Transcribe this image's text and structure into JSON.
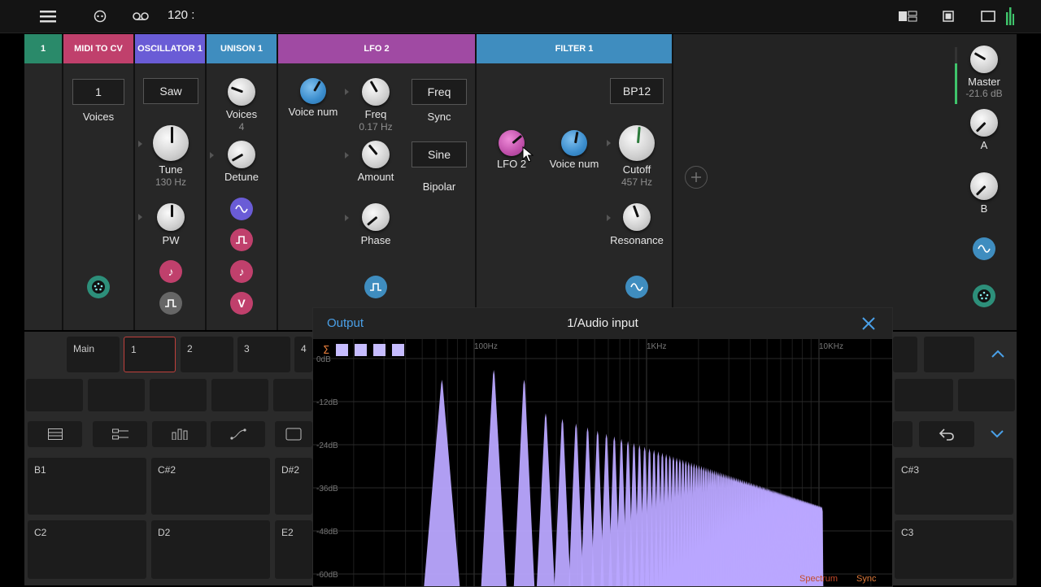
{
  "topbar": {
    "tempo": "120 :",
    "icons": [
      "menu-icon",
      "link-icon",
      "cassette-icon",
      "layout-icon",
      "single-view-icon",
      "window-icon",
      "level-meter-icon"
    ]
  },
  "tracks": {
    "selected": "1"
  },
  "modules": {
    "midi_to_cv": {
      "title": "MIDI TO CV",
      "voices_value": "1",
      "voices_label": "Voices",
      "color": "#c0406c"
    },
    "oscillator": {
      "title": "OSCILLATOR 1",
      "wave_value": "Saw",
      "tune_label": "Tune",
      "tune_value": "130 Hz",
      "pw_label": "PW",
      "color": "#6a5cd6"
    },
    "unison": {
      "title": "UNISON 1",
      "voices_label": "Voices",
      "voices_value": "4",
      "detune_label": "Detune",
      "color": "#3f8dbf",
      "v_label": "V"
    },
    "lfo": {
      "title": "LFO 2",
      "voice_num_label": "Voice num",
      "freq_label": "Freq",
      "freq_value": "0.17 Hz",
      "freq_mode": "Freq",
      "sync_label": "Sync",
      "amount_label": "Amount",
      "shape_value": "Sine",
      "bipolar_label": "Bipolar",
      "phase_label": "Phase",
      "color": "#a04aa3"
    },
    "filter": {
      "title": "FILTER 1",
      "type_value": "BP12",
      "lfo_label": "LFO 2",
      "voice_num_label": "Voice num",
      "cutoff_label": "Cutoff",
      "cutoff_value": "457 Hz",
      "resonance_label": "Resonance",
      "color": "#3f8dbf"
    }
  },
  "master": {
    "label": "Master",
    "db": "-21.6 dB",
    "a_label": "A",
    "b_label": "B"
  },
  "scenes": [
    "Main",
    "1",
    "2",
    "3",
    "4"
  ],
  "tools": [
    "list-icon",
    "sliders-icon",
    "bars-icon",
    "curve-icon",
    "rect-icon"
  ],
  "pads_row1": [
    "B1",
    "C#2",
    "D#2",
    "C#3"
  ],
  "pads_row2": [
    "C2",
    "D2",
    "E2",
    "C3"
  ],
  "overlay": {
    "tab": "Output",
    "title": "1/Audio input",
    "freq_labels": [
      "100Hz",
      "1KHz",
      "10KHz"
    ],
    "db_labels": [
      "0dB",
      "-12dB",
      "-24dB",
      "-36dB",
      "-48dB",
      "-60dB"
    ],
    "sigma": "Σ",
    "footer_spectrum": "Spectrum",
    "footer_sync": "Sync",
    "spectrum_color": "#b9a6ff"
  }
}
